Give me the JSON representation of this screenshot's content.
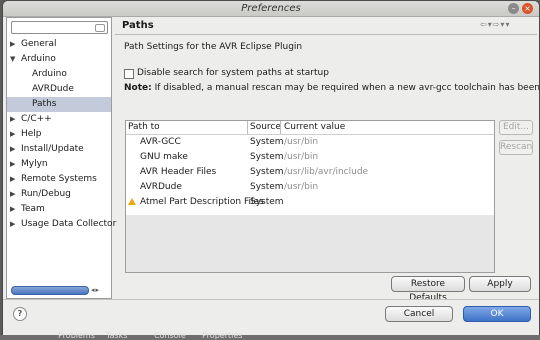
{
  "window": {
    "title": "Preferences"
  },
  "left": {
    "filter_placeholder": "",
    "tree": [
      {
        "label": "General",
        "expanded": false,
        "child": false
      },
      {
        "label": "Arduino",
        "expanded": true,
        "child": false
      },
      {
        "label": "Arduino",
        "child": true
      },
      {
        "label": "AVRDude",
        "child": true
      },
      {
        "label": "Paths",
        "child": true,
        "selected": true
      },
      {
        "label": "C/C++",
        "expanded": false,
        "child": false
      },
      {
        "label": "Help",
        "expanded": false,
        "child": false
      },
      {
        "label": "Install/Update",
        "expanded": false,
        "child": false
      },
      {
        "label": "Mylyn",
        "expanded": false,
        "child": false
      },
      {
        "label": "Remote Systems",
        "expanded": false,
        "child": false
      },
      {
        "label": "Run/Debug",
        "expanded": false,
        "child": false
      },
      {
        "label": "Team",
        "expanded": false,
        "child": false
      },
      {
        "label": "Usage Data Collector",
        "expanded": false,
        "child": false
      }
    ]
  },
  "page": {
    "title": "Paths",
    "subtitle": "Path Settings for the AVR Eclipse Plugin",
    "checkbox_label": "Disable search for system paths at startup",
    "checkbox_checked": false,
    "note_label": "Note:",
    "note_text": " If disabled, a manual rescan may be required when a new avr-gcc toolchain has been installed."
  },
  "table": {
    "headers": [
      "Path to",
      "Source",
      "Current value"
    ],
    "rows": [
      {
        "path": "AVR-GCC",
        "source": "System",
        "value": "/usr/bin",
        "warning": false
      },
      {
        "path": "GNU make",
        "source": "System",
        "value": "/usr/bin",
        "warning": false
      },
      {
        "path": "AVR Header Files",
        "source": "System",
        "value": "/usr/lib/avr/include",
        "warning": false
      },
      {
        "path": "AVRDude",
        "source": "System",
        "value": "/usr/bin",
        "warning": false
      },
      {
        "path": "Atmel Part Description Files",
        "source": "System",
        "value": "",
        "warning": true
      }
    ]
  },
  "buttons": {
    "edit": "Edit...",
    "rescan": "Rescan",
    "restore_defaults": "Restore Defaults",
    "apply": "Apply",
    "cancel": "Cancel",
    "ok": "OK",
    "help": "?"
  },
  "taskbar": {
    "items": [
      "Problems",
      "Tasks",
      "Console",
      "Properties"
    ]
  },
  "colors": {
    "selection": "#c3cbdb",
    "ok_button": "#3f72c9",
    "warning": "#e9a81b"
  }
}
